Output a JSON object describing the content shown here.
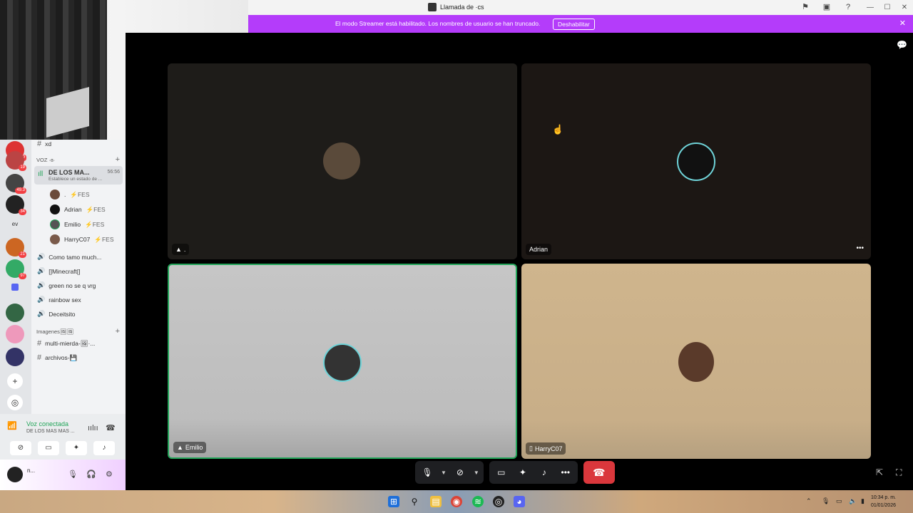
{
  "window": {
    "title": "Llamada de ·cs"
  },
  "banner": {
    "message": "El modo Streamer está habilitado. Los nombres de usuario se han truncado.",
    "button": "Deshabilitar"
  },
  "rail": {
    "servers": [
      {
        "badge": "9"
      },
      {
        "badge": "19"
      },
      {
        "badge": "49.3"
      },
      {
        "badge": "34"
      },
      {
        "text": "ev"
      },
      {
        "badge": "21"
      },
      {
        "badge": "97"
      },
      {
        "badge": ""
      },
      {
        "badge": ""
      },
      {
        "badge": ""
      }
    ]
  },
  "channels": {
    "top_text_channel": "xd",
    "voice_category": "VOZ ·ɞ·",
    "active_voice": {
      "name": "DE LOS MA...",
      "status": "Establece un estado de ...",
      "time": "56:56"
    },
    "members": [
      {
        "name": ".",
        "tag": "⚡FES"
      },
      {
        "name": "Adrian",
        "tag": "⚡FES"
      },
      {
        "name": "Emilio",
        "tag": "⚡FES"
      },
      {
        "name": "HarryC07",
        "tag": "⚡FES"
      }
    ],
    "voice_channels": [
      "Como tamo much...",
      "[]Minecraft[]",
      "green no se q vrg",
      "rainbow sex",
      "Deceitsito"
    ],
    "images_category": "Imagenes🖼🖼",
    "text_channels": [
      "multi-mierda-🖼·...",
      "archivos-💾"
    ]
  },
  "voice_panel": {
    "title": "Voz conectada",
    "subtitle": "DE LOS MAS MAS ...",
    "user_name": "n..."
  },
  "tiles": [
    {
      "label": "."
    },
    {
      "label": "Adrian"
    },
    {
      "label": "Emilio"
    },
    {
      "label": "HarryC07"
    }
  ],
  "taskbar": {
    "time": "10:34 p. m.",
    "date": "01/01/2026"
  },
  "colors": {
    "banner": "#b43cfa",
    "speaking_border": "#23a55a",
    "hangup": "#da373c"
  }
}
